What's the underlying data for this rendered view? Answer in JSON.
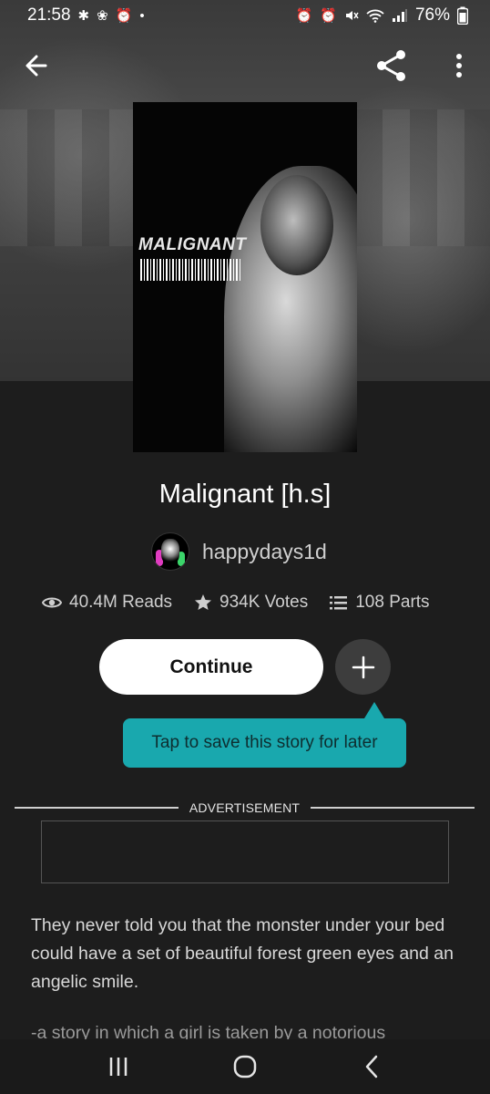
{
  "status_bar": {
    "time": "21:58",
    "battery": "76%",
    "left_icons": [
      "accessibility-icon",
      "flower-icon",
      "alarm-icon",
      "dot-icon"
    ],
    "right_icons": [
      "alarm-clock-icon",
      "alarm-icon",
      "mute-icon",
      "wifi-icon",
      "signal-icon",
      "battery-icon"
    ]
  },
  "appbar": {
    "back_icon": "arrow-left-icon",
    "share_icon": "share-icon",
    "more_icon": "more-vertical-icon"
  },
  "cover": {
    "title_text": "MALIGNANT"
  },
  "story": {
    "title": "Malignant [h.s]",
    "author": "happydays1d",
    "reads": "40.4M Reads",
    "votes": "934K Votes",
    "parts": "108 Parts"
  },
  "actions": {
    "continue_label": "Continue",
    "add_icon": "plus-icon",
    "tooltip": "Tap to save this story for later"
  },
  "ad": {
    "label": "ADVERTISEMENT"
  },
  "description": {
    "paragraph1": "They never told you that the monster under your bed could have a set of beautiful forest green eyes and an angelic smile.",
    "paragraph2_partial": "-a story in which a girl is taken by a notorious"
  },
  "navbar": {
    "recents_icon": "recents-icon",
    "home_icon": "home-icon",
    "back_icon": "chevron-left-icon"
  },
  "colors": {
    "tooltip_bg": "#19a8ae",
    "background": "#1d1d1d",
    "continue_bg": "#ffffff"
  }
}
